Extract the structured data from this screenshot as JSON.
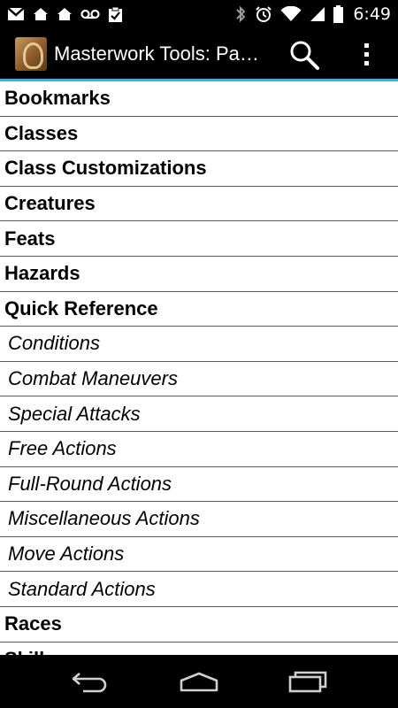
{
  "status_bar": {
    "time": "6:49",
    "left_icons": [
      "gmail-icon",
      "home-icon",
      "home-icon",
      "voicemail-icon",
      "clipboard-check-icon"
    ],
    "right_icons": [
      "bluetooth-icon",
      "alarm-icon",
      "wifi-icon",
      "signal-icon",
      "battery-icon"
    ]
  },
  "action_bar": {
    "title": "Masterwork Tools: Pa…",
    "accent_color": "#33b5e5"
  },
  "list": {
    "items": [
      {
        "label": "Bookmarks",
        "type": "header"
      },
      {
        "label": "Classes",
        "type": "header"
      },
      {
        "label": "Class Customizations",
        "type": "header"
      },
      {
        "label": "Creatures",
        "type": "header"
      },
      {
        "label": "Feats",
        "type": "header"
      },
      {
        "label": "Hazards",
        "type": "header"
      },
      {
        "label": "Quick Reference",
        "type": "header"
      },
      {
        "label": "Conditions",
        "type": "sub"
      },
      {
        "label": "Combat Maneuvers",
        "type": "sub"
      },
      {
        "label": "Special Attacks",
        "type": "sub"
      },
      {
        "label": "Free Actions",
        "type": "sub"
      },
      {
        "label": "Full-Round Actions",
        "type": "sub"
      },
      {
        "label": "Miscellaneous Actions",
        "type": "sub"
      },
      {
        "label": "Move Actions",
        "type": "sub"
      },
      {
        "label": "Standard Actions",
        "type": "sub"
      },
      {
        "label": "Races",
        "type": "header"
      },
      {
        "label": "Skills",
        "type": "header"
      }
    ]
  },
  "nav_bar": {
    "buttons": [
      "back-icon",
      "home-icon",
      "recent-apps-icon"
    ]
  }
}
